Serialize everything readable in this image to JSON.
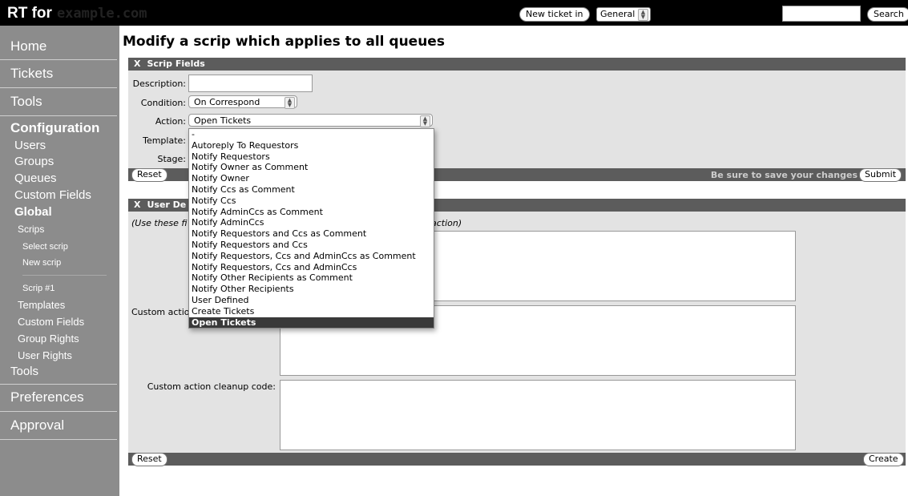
{
  "topbar": {
    "brand_prefix": "RT for",
    "brand_host": "example.com",
    "new_ticket_label": "New ticket in",
    "queue_value": "General",
    "search_label": "Search"
  },
  "sidebar": {
    "home": "Home",
    "tickets": "Tickets",
    "tools": "Tools",
    "configuration": "Configuration",
    "users": "Users",
    "groups": "Groups",
    "queues": "Queues",
    "custom_fields": "Custom Fields",
    "global": "Global",
    "scrips": "Scrips",
    "select_scrip": "Select scrip",
    "new_scrip": "New scrip",
    "scrip_1": "Scrip #1",
    "templates": "Templates",
    "global_custom_fields": "Custom Fields",
    "group_rights": "Group Rights",
    "user_rights": "User Rights",
    "global_tools": "Tools",
    "preferences": "Preferences",
    "approval": "Approval"
  },
  "page": {
    "title": "Modify a scrip which applies to all queues"
  },
  "scrip_fields": {
    "header_x": "X",
    "header": "Scrip Fields",
    "description_label": "Description:",
    "description_value": "",
    "condition_label": "Condition:",
    "condition_value": "On Correspond",
    "action_label": "Action:",
    "action_value": "Open Tickets",
    "template_label": "Template:",
    "stage_label": "Stage:",
    "reset_label": "Reset",
    "save_note": "Be sure to save your changes",
    "submit_label": "Submit"
  },
  "user_defined": {
    "header_x": "X",
    "header_visible": "User De",
    "hint_visible_left": "(Use these fi",
    "hint_visible_right": "action)",
    "custom_action_label_visible": "Custom actio",
    "cleanup_label": "Custom action cleanup code:",
    "reset_label": "Reset",
    "create_label": "Create"
  },
  "action_options": [
    "-",
    "Autoreply To Requestors",
    "Notify Requestors",
    "Notify Owner as Comment",
    "Notify Owner",
    "Notify Ccs as Comment",
    "Notify Ccs",
    "Notify AdminCcs as Comment",
    "Notify AdminCcs",
    "Notify Requestors and Ccs as Comment",
    "Notify Requestors and Ccs",
    "Notify Requestors, Ccs and AdminCcs as Comment",
    "Notify Requestors, Ccs and AdminCcs",
    "Notify Other Recipients as Comment",
    "Notify Other Recipients",
    "User Defined",
    "Create Tickets",
    "Open Tickets"
  ],
  "selected_action_index": 17
}
